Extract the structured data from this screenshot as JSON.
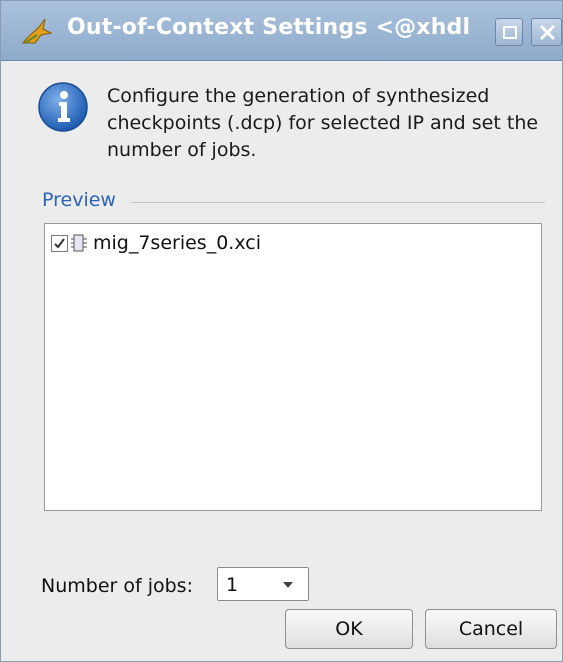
{
  "window": {
    "title": "Out-of-Context Settings <@xhdl",
    "icons": {
      "app": "vivado-leaf-icon",
      "maximize": "maximize-icon",
      "close": "close-icon"
    }
  },
  "info": {
    "icon": "info-icon",
    "message": "Configure the generation of synthesized checkpoints (.dcp) for selected IP and set the number of jobs."
  },
  "preview": {
    "label": "Preview",
    "items": [
      {
        "label": "mig_7series_0.xci",
        "checked": true,
        "icon": "ip-core-icon"
      }
    ]
  },
  "jobs": {
    "label": "Number of jobs:",
    "value": "1"
  },
  "buttons": {
    "ok": "OK",
    "cancel": "Cancel"
  },
  "colors": {
    "titlebar": "#9ab5d4",
    "preview_label": "#2a63b8",
    "info_icon": "#2f6fc4"
  }
}
